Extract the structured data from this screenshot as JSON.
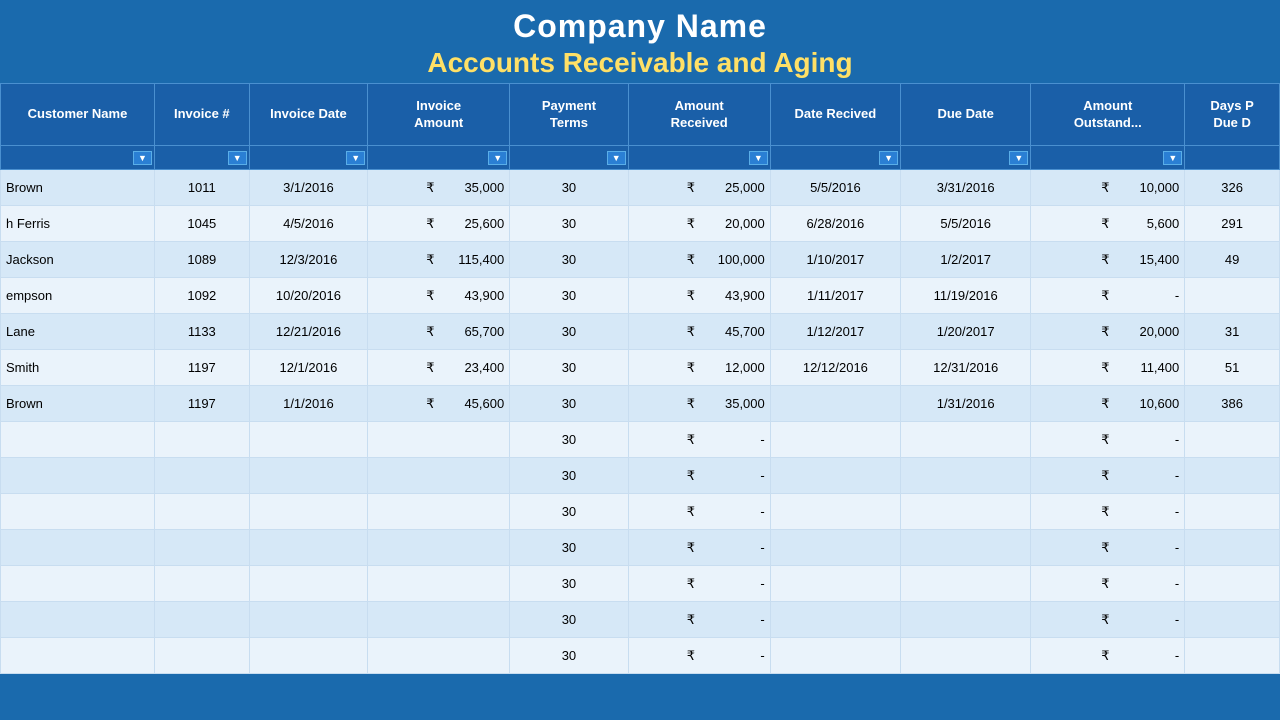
{
  "header": {
    "company_name": "Company Name",
    "subtitle": "Accounts Receivable and Aging"
  },
  "columns": [
    {
      "id": "customer",
      "label": "Customer Name",
      "class": "col-customer"
    },
    {
      "id": "invoice_num",
      "label": "Invoice #",
      "class": "col-invoice"
    },
    {
      "id": "invoice_date",
      "label": "Invoice Date",
      "class": "col-inv-date"
    },
    {
      "id": "invoice_amount",
      "label": "Invoice Amount",
      "class": "col-inv-amount"
    },
    {
      "id": "payment_terms",
      "label": "Payment Terms",
      "class": "col-payment"
    },
    {
      "id": "amount_received",
      "label": "Amount Received",
      "class": "col-amt-received"
    },
    {
      "id": "date_received",
      "label": "Date Recived",
      "class": "col-date-received"
    },
    {
      "id": "due_date",
      "label": "Due Date",
      "class": "col-due-date"
    },
    {
      "id": "amount_outstanding",
      "label": "Amount Outstanding",
      "class": "col-amt-outstanding"
    },
    {
      "id": "days_past_due",
      "label": "Days Past Due D",
      "class": "col-days-due"
    }
  ],
  "rows": [
    {
      "customer": "Brown",
      "invoice_num": "1011",
      "invoice_date": "3/1/2016",
      "invoice_amount": "35,000",
      "payment_terms": "30",
      "amount_received": "25,000",
      "date_received": "5/5/2016",
      "due_date": "3/31/2016",
      "amount_outstanding": "10,000",
      "days_past_due": "326"
    },
    {
      "customer": "h Ferris",
      "invoice_num": "1045",
      "invoice_date": "4/5/2016",
      "invoice_amount": "25,600",
      "payment_terms": "30",
      "amount_received": "20,000",
      "date_received": "6/28/2016",
      "due_date": "5/5/2016",
      "amount_outstanding": "5,600",
      "days_past_due": "291"
    },
    {
      "customer": "Jackson",
      "invoice_num": "1089",
      "invoice_date": "12/3/2016",
      "invoice_amount": "115,400",
      "payment_terms": "30",
      "amount_received": "100,000",
      "date_received": "1/10/2017",
      "due_date": "1/2/2017",
      "amount_outstanding": "15,400",
      "days_past_due": "49"
    },
    {
      "customer": "empson",
      "invoice_num": "1092",
      "invoice_date": "10/20/2016",
      "invoice_amount": "43,900",
      "payment_terms": "30",
      "amount_received": "43,900",
      "date_received": "1/11/2017",
      "due_date": "11/19/2016",
      "amount_outstanding": "-",
      "days_past_due": ""
    },
    {
      "customer": "Lane",
      "invoice_num": "1133",
      "invoice_date": "12/21/2016",
      "invoice_amount": "65,700",
      "payment_terms": "30",
      "amount_received": "45,700",
      "date_received": "1/12/2017",
      "due_date": "1/20/2017",
      "amount_outstanding": "20,000",
      "days_past_due": "31"
    },
    {
      "customer": "Smith",
      "invoice_num": "1197",
      "invoice_date": "12/1/2016",
      "invoice_amount": "23,400",
      "payment_terms": "30",
      "amount_received": "12,000",
      "date_received": "12/12/2016",
      "due_date": "12/31/2016",
      "amount_outstanding": "11,400",
      "days_past_due": "51"
    },
    {
      "customer": "Brown",
      "invoice_num": "1197",
      "invoice_date": "1/1/2016",
      "invoice_amount": "45,600",
      "payment_terms": "30",
      "amount_received": "35,000",
      "date_received": "",
      "due_date": "1/31/2016",
      "amount_outstanding": "10,600",
      "days_past_due": "386"
    },
    {
      "customer": "",
      "invoice_num": "",
      "invoice_date": "",
      "invoice_amount": "",
      "payment_terms": "30",
      "amount_received": "-",
      "date_received": "",
      "due_date": "",
      "amount_outstanding": "-",
      "days_past_due": ""
    },
    {
      "customer": "",
      "invoice_num": "",
      "invoice_date": "",
      "invoice_amount": "",
      "payment_terms": "30",
      "amount_received": "-",
      "date_received": "",
      "due_date": "",
      "amount_outstanding": "-",
      "days_past_due": ""
    },
    {
      "customer": "",
      "invoice_num": "",
      "invoice_date": "",
      "invoice_amount": "",
      "payment_terms": "30",
      "amount_received": "-",
      "date_received": "",
      "due_date": "",
      "amount_outstanding": "-",
      "days_past_due": ""
    },
    {
      "customer": "",
      "invoice_num": "",
      "invoice_date": "",
      "invoice_amount": "",
      "payment_terms": "30",
      "amount_received": "-",
      "date_received": "",
      "due_date": "",
      "amount_outstanding": "-",
      "days_past_due": ""
    },
    {
      "customer": "",
      "invoice_num": "",
      "invoice_date": "",
      "invoice_amount": "",
      "payment_terms": "30",
      "amount_received": "-",
      "date_received": "",
      "due_date": "",
      "amount_outstanding": "-",
      "days_past_due": ""
    },
    {
      "customer": "",
      "invoice_num": "",
      "invoice_date": "",
      "invoice_amount": "",
      "payment_terms": "30",
      "amount_received": "-",
      "date_received": "",
      "due_date": "",
      "amount_outstanding": "-",
      "days_past_due": ""
    },
    {
      "customer": "",
      "invoice_num": "",
      "invoice_date": "",
      "invoice_amount": "",
      "payment_terms": "30",
      "amount_received": "-",
      "date_received": "",
      "due_date": "",
      "amount_outstanding": "-",
      "days_past_due": ""
    }
  ],
  "colors": {
    "header_bg": "#1a5fa8",
    "row_odd": "#d6e8f7",
    "row_even": "#eaf3fb",
    "header_text": "#ffffff",
    "title_bg": "#1a6aad"
  }
}
